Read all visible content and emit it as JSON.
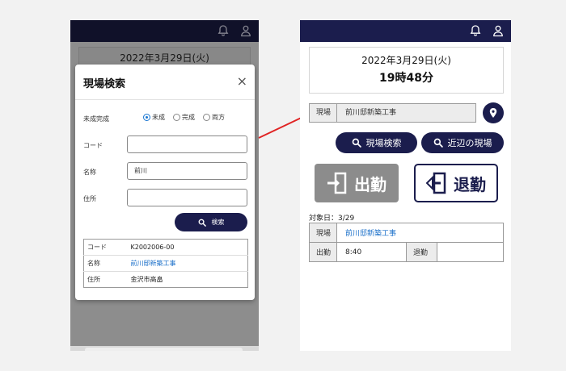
{
  "left": {
    "date_text": "2022年3月29日(火)",
    "modal": {
      "title": "現場検索",
      "close_symbol": "×",
      "status_label": "未成完成",
      "status_options": [
        "未成",
        "完成",
        "両方"
      ],
      "status_selected": "未成",
      "code_label": "コード",
      "code_value": "",
      "name_label": "名称",
      "name_value": "前川",
      "address_label": "住所",
      "address_value": "",
      "search_button_label": "検索",
      "result": {
        "code_label": "コード",
        "code_value": "K2002006-00",
        "name_label": "名称",
        "name_value": "前川邸新築工事",
        "address_label": "住所",
        "address_value": "金沢市高畠"
      }
    }
  },
  "right": {
    "date_text": "2022年3月29日(火)",
    "time_text": "19時48分",
    "site_label": "現場",
    "site_value": "前川邸新築工事",
    "site_search_button": "現場検索",
    "nearby_sites_button": "近辺の現場",
    "clock_in_label": "出勤",
    "clock_out_label": "退勤",
    "target_date_text": "対象日：3/29",
    "record": {
      "site_label": "現場",
      "site_value": "前川邸新築工事",
      "in_label": "出勤",
      "in_value": "8:40",
      "out_label": "退勤",
      "out_value": ""
    }
  },
  "colors": {
    "navy": "#1b1d4d",
    "link": "#1a6fc9",
    "radio_selected": "#1976d2",
    "arrow": "#e02424"
  },
  "icons": [
    "bell-icon",
    "user-icon",
    "search-icon",
    "location-pin-icon",
    "door-enter-icon",
    "door-exit-icon"
  ]
}
